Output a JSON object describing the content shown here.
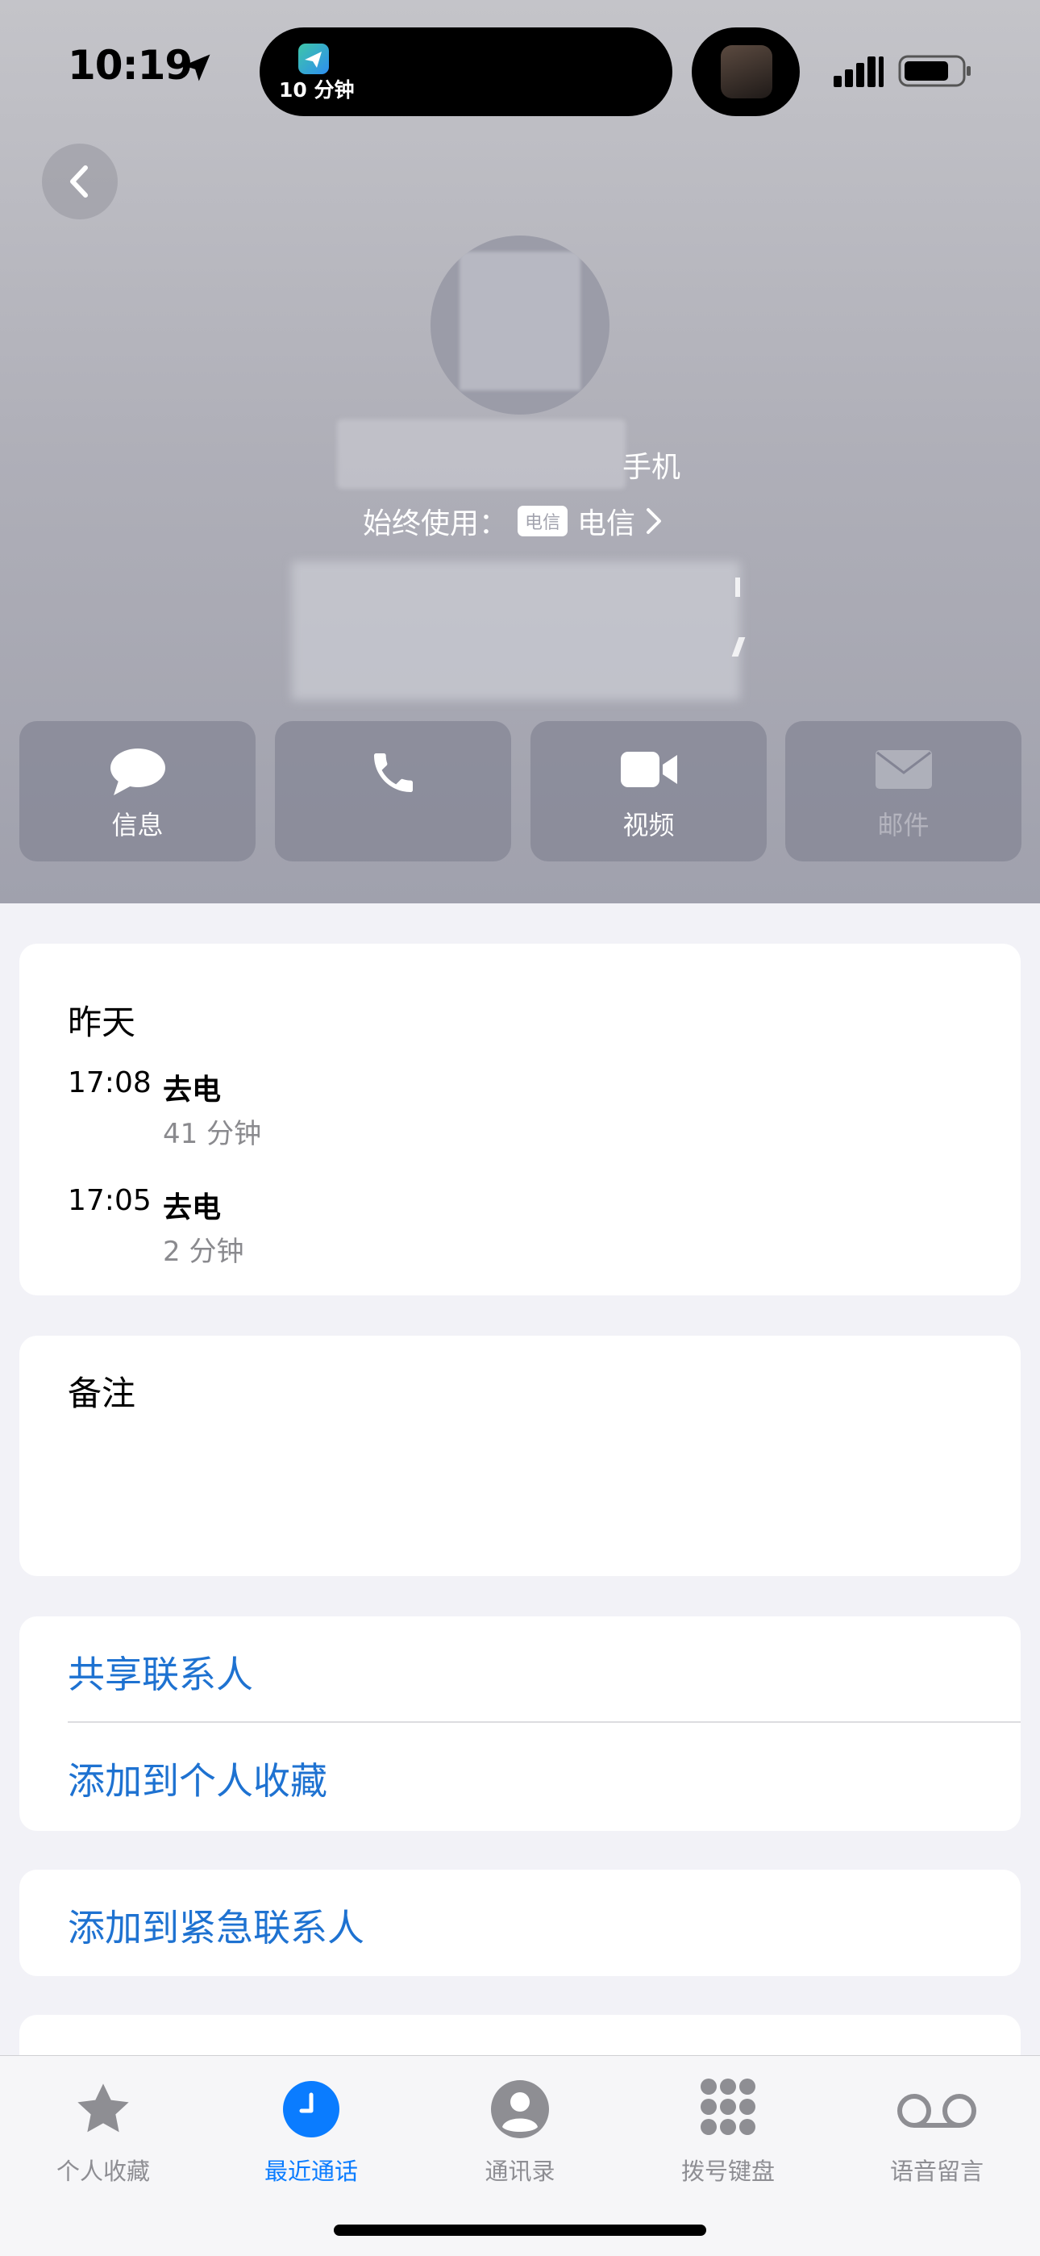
{
  "status_bar": {
    "time": "10:19",
    "island_timer": "10 分钟"
  },
  "contact": {
    "number_label": "手机",
    "always_use_label": "始终使用：",
    "carrier_badge": "电信",
    "carrier_name": "电信"
  },
  "actions": [
    {
      "label": "信息",
      "icon": "message-icon",
      "enabled": true
    },
    {
      "label": "",
      "icon": "phone-icon",
      "enabled": true
    },
    {
      "label": "视频",
      "icon": "video-icon",
      "enabled": true
    },
    {
      "label": "邮件",
      "icon": "mail-icon",
      "enabled": false
    }
  ],
  "recent_calls": {
    "date": "昨天",
    "calls": [
      {
        "time": "17:08",
        "type": "去电",
        "duration": "41 分钟"
      },
      {
        "time": "17:05",
        "type": "去电",
        "duration": "2 分钟"
      }
    ]
  },
  "notes": {
    "title": "备注"
  },
  "links": {
    "share_contact": "共享联系人",
    "add_to_favorites": "添加到个人收藏",
    "add_to_emergency": "添加到紧急联系人"
  },
  "tab_bar": [
    {
      "label": "个人收藏",
      "icon": "star-icon",
      "active": false
    },
    {
      "label": "最近通话",
      "icon": "clock-icon",
      "active": true
    },
    {
      "label": "通讯录",
      "icon": "person-icon",
      "active": false
    },
    {
      "label": "拨号键盘",
      "icon": "keypad-icon",
      "active": false
    },
    {
      "label": "语音留言",
      "icon": "voicemail-icon",
      "active": false
    }
  ],
  "colors": {
    "link_blue": "#1e72d1",
    "active_tab": "#0a7cff",
    "destructive_red": "#e5312a"
  }
}
